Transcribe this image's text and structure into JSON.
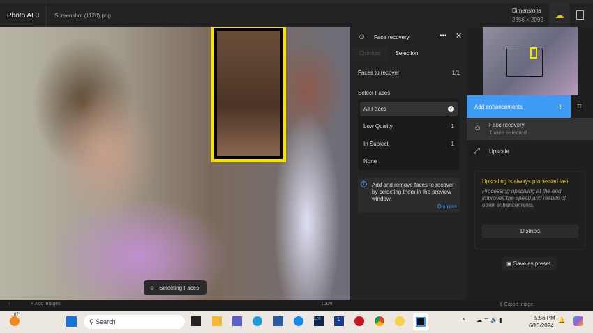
{
  "app": {
    "name": "Photo AI",
    "version": "3",
    "filename": "Screenshot (1120).png",
    "dimensions_label": "Dimensions",
    "dimensions_value": "2856 × 2092"
  },
  "canvas": {
    "status": "Selecting Faces"
  },
  "bottom": {
    "add_images": "Add images",
    "zoom": "100%",
    "export": "Export image"
  },
  "panel": {
    "title": "Face recovery",
    "tabs": [
      "Controls",
      "Selection"
    ],
    "faces_label": "Faces to recover",
    "faces_value": "1/1",
    "select_label": "Select Faces",
    "options": [
      {
        "label": "All Faces",
        "count": "",
        "selected": true
      },
      {
        "label": "Low Quality",
        "count": "1"
      },
      {
        "label": "In Subject",
        "count": "1"
      },
      {
        "label": "None",
        "count": ""
      }
    ],
    "info": "Add and remove faces to recover by selecting them in the preview window.",
    "info_dismiss": "Dismiss"
  },
  "right": {
    "add_enh": "Add enhancements",
    "items": [
      {
        "title": "Face recovery",
        "sub": "1 face selected"
      },
      {
        "title": "Upscale"
      }
    ],
    "note_title": "Upscaling is always processed last",
    "note_body": "Processing upscaling at the end improves the speed and results of other enhancements.",
    "note_dismiss": "Dismiss",
    "save_preset": "Save as preset"
  },
  "taskbar": {
    "weather": "87°",
    "search": "Search",
    "time": "5:56 PM",
    "date": "6/13/2024"
  },
  "colors": {
    "accent": "#3d9bf5",
    "yellow": "#f2e400",
    "note": "#e9c62f"
  }
}
